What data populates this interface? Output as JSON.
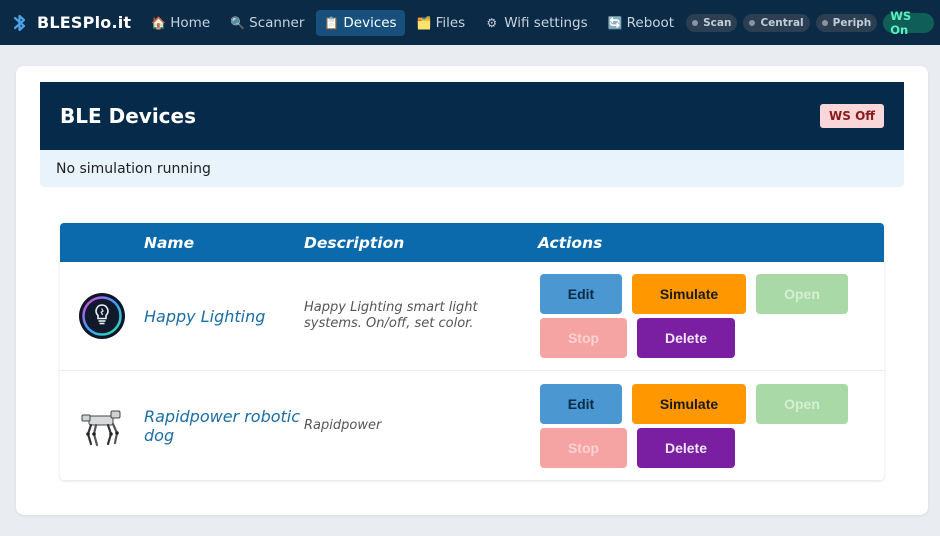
{
  "nav": {
    "brand": "BLESPlo.it",
    "items": [
      {
        "icon": "house-icon",
        "glyph": "🏠",
        "label": "Home"
      },
      {
        "icon": "search-icon",
        "glyph": "🔍",
        "label": "Scanner"
      },
      {
        "icon": "clipboard-icon",
        "glyph": "📋",
        "label": "Devices",
        "active": true
      },
      {
        "icon": "folder-icon",
        "glyph": "🗂️",
        "label": "Files"
      },
      {
        "icon": "gear-icon",
        "glyph": "⚙",
        "label": "Wifi settings"
      },
      {
        "icon": "refresh-icon",
        "glyph": "🔄",
        "label": "Reboot"
      }
    ],
    "pills": {
      "scan": "Scan",
      "central": "Central",
      "periph": "Periph",
      "ws": "WS On"
    }
  },
  "header": {
    "title": "BLE Devices",
    "ws_badge": "WS Off"
  },
  "status": "No simulation running",
  "table": {
    "columns": {
      "name": "Name",
      "description": "Description",
      "actions": "Actions"
    },
    "rows": [
      {
        "image": "lightbulb-icon",
        "name": "Happy Lighting",
        "description": "Happy Lighting smart light systems. On/off, set color."
      },
      {
        "image": "robot-dog-image",
        "name": "Rapidpower robotic dog",
        "description": "Rapidpower"
      }
    ],
    "actions": {
      "edit": "Edit",
      "simulate": "Simulate",
      "open": "Open",
      "stop": "Stop",
      "delete": "Delete"
    }
  },
  "colors": {
    "nav_bg": "#0b2a45",
    "header_bg": "#052a4a",
    "table_header": "#0a6aab",
    "edit": "#4a97d1",
    "simulate": "#ff9800",
    "open_disabled": "#a8d9a7",
    "stop_disabled": "#f6a3a3",
    "delete": "#7b1fa2",
    "ws_on": "#0f5f58",
    "ws_off_badge": "#f9d6d8"
  }
}
